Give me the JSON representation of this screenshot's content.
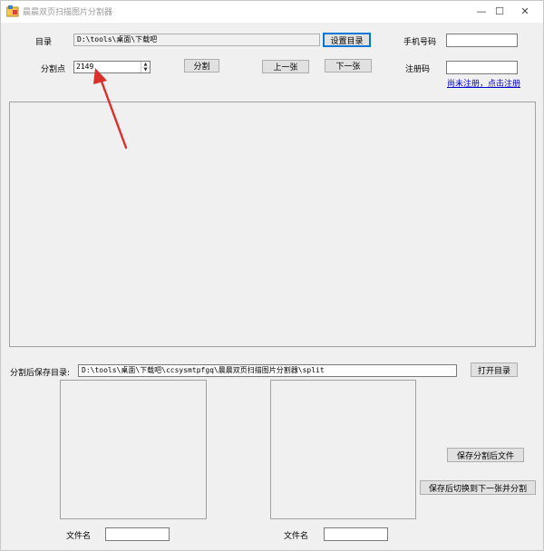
{
  "window": {
    "title": "晨晨双页扫描图片分割器",
    "controls": {
      "minimize": "—",
      "maximize": "☐",
      "close": "✕"
    }
  },
  "top": {
    "dir_label": "目录",
    "dir_value": "D:\\tools\\桌面\\下载吧",
    "set_dir_button": "设置目录",
    "phone_label": "手机号码",
    "phone_value": "",
    "split_point_label": "分割点",
    "split_point_value": "2149",
    "split_button": "分割",
    "prev_button": "上一张",
    "next_button": "下一张",
    "reg_code_label": "注册码",
    "reg_code_value": "",
    "register_link": "尚未注册，点击注册"
  },
  "bottom": {
    "save_dir_label": "分割后保存目录:",
    "save_dir_value": "D:\\tools\\桌面\\下载吧\\ccsysmtpfgq\\晨晨双页扫描图片分割器\\split",
    "open_dir_button": "打开目录",
    "save_split_button": "保存分割后文件",
    "save_next_button": "保存后切换到下一张并分割",
    "left_filename_label": "文件名",
    "left_filename_value": "",
    "right_filename_label": "文件名",
    "right_filename_value": ""
  },
  "colors": {
    "annotation_arrow": "#d9302c",
    "link": "#0000cc",
    "focus": "#0078d7"
  }
}
